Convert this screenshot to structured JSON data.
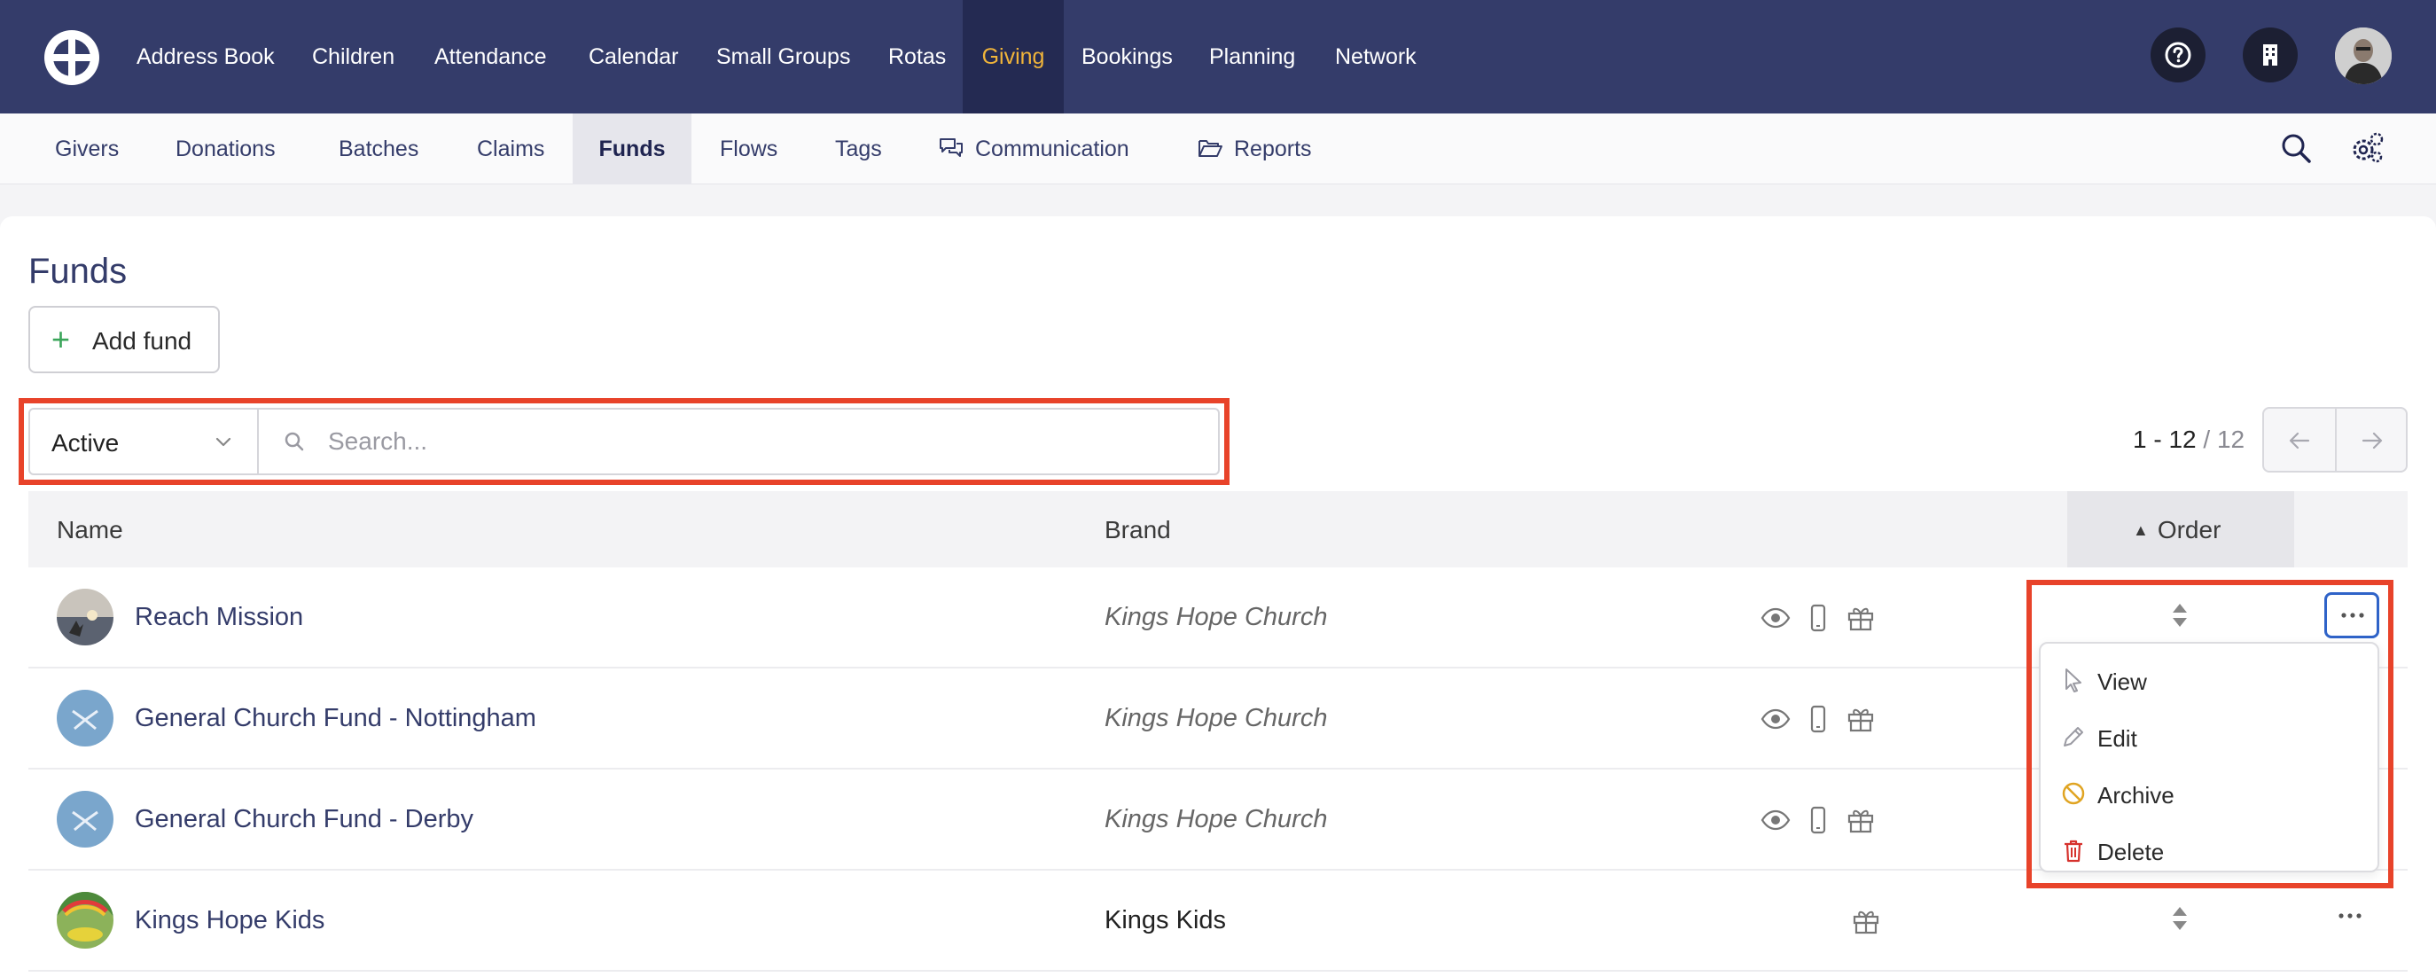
{
  "nav": {
    "items": [
      {
        "label": "Address Book",
        "active": false
      },
      {
        "label": "Children",
        "active": false
      },
      {
        "label": "Attendance",
        "active": false
      },
      {
        "label": "Calendar",
        "active": false
      },
      {
        "label": "Small Groups",
        "active": false
      },
      {
        "label": "Rotas",
        "active": false
      },
      {
        "label": "Giving",
        "active": true
      },
      {
        "label": "Bookings",
        "active": false
      },
      {
        "label": "Planning",
        "active": false
      },
      {
        "label": "Network",
        "active": false
      }
    ],
    "active_color": "#f0b43a",
    "bg_color": "#343c6a"
  },
  "subnav": {
    "items": [
      {
        "label": "Givers"
      },
      {
        "label": "Donations"
      },
      {
        "label": "Batches"
      },
      {
        "label": "Claims"
      },
      {
        "label": "Funds",
        "active": true
      },
      {
        "label": "Flows"
      },
      {
        "label": "Tags"
      },
      {
        "label": "Communication",
        "icon": "chat-bubbles-icon"
      },
      {
        "label": "Reports",
        "icon": "folder-open-icon"
      }
    ]
  },
  "page": {
    "title": "Funds",
    "add_button": "Add fund"
  },
  "filter": {
    "status_value": "Active",
    "search_placeholder": "Search..."
  },
  "pagination": {
    "range": "1 - 12",
    "total": "/ 12"
  },
  "table": {
    "columns": {
      "name": "Name",
      "brand": "Brand",
      "order": "Order"
    },
    "rows": [
      {
        "name": "Reach Mission",
        "brand": "Kings Hope Church",
        "brand_italic": true,
        "visible": true,
        "mobile": true,
        "gift": true
      },
      {
        "name": "General Church Fund - Nottingham",
        "brand": "Kings Hope Church",
        "brand_italic": true,
        "visible": true,
        "mobile": true,
        "gift": true
      },
      {
        "name": "General Church Fund - Derby",
        "brand": "Kings Hope Church",
        "brand_italic": true,
        "visible": true,
        "mobile": true,
        "gift": true
      },
      {
        "name": "Kings Hope Kids",
        "brand": "Kings Kids",
        "brand_italic": false,
        "visible": false,
        "mobile": false,
        "gift": true
      }
    ]
  },
  "dropdown": {
    "items": [
      {
        "label": "View",
        "icon": "cursor-icon",
        "color": "#9a9aa2"
      },
      {
        "label": "Edit",
        "icon": "pencil-icon",
        "color": "#9a9aa2"
      },
      {
        "label": "Archive",
        "icon": "archive-prohibited-icon",
        "color": "#e0a422"
      },
      {
        "label": "Delete",
        "icon": "trash-icon",
        "color": "#d6322d"
      }
    ]
  },
  "highlight_color": "#e8432a"
}
